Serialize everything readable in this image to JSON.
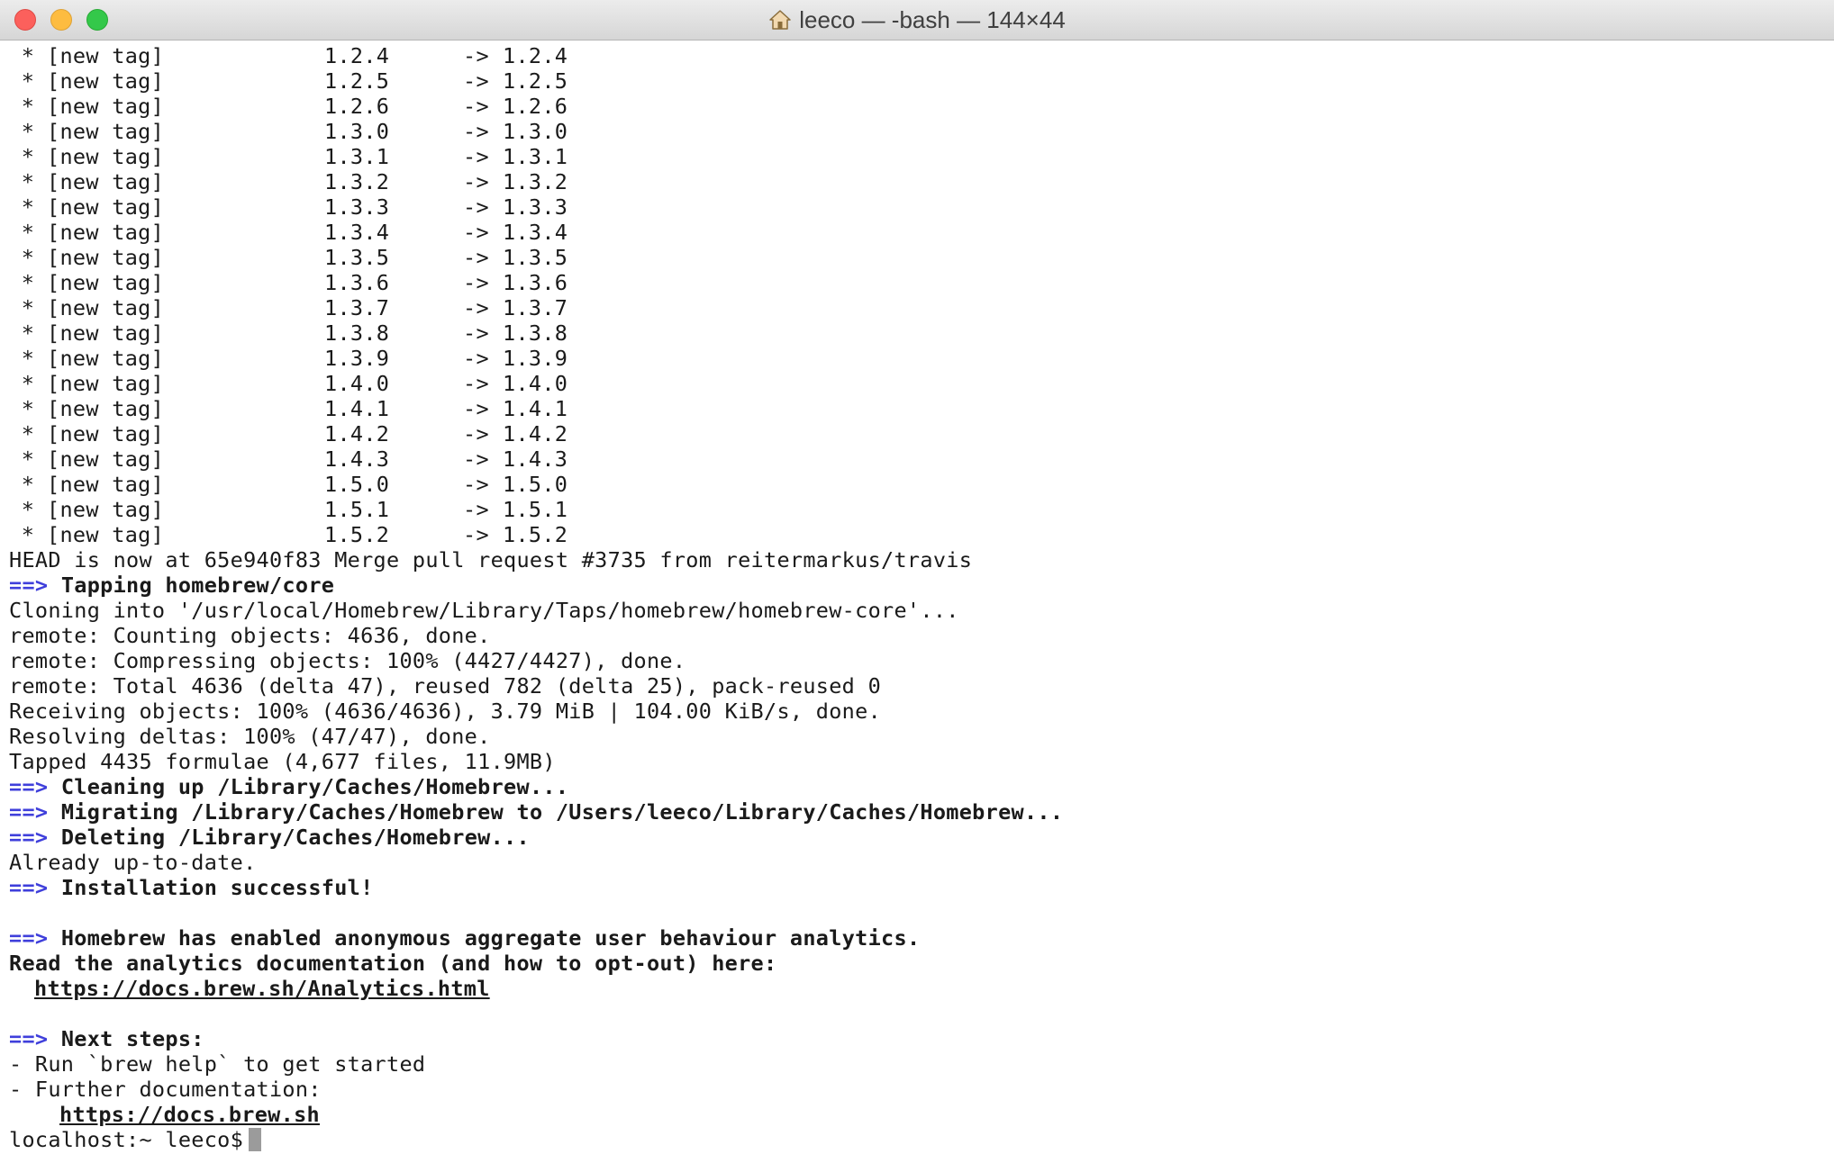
{
  "window": {
    "title": "leeco — -bash — 144×44",
    "icon": "home-folder-icon"
  },
  "tags": [
    {
      "star": "*",
      "label": "[new tag]",
      "from": "1.2.4",
      "arrow": "->",
      "to": "1.2.4"
    },
    {
      "star": "*",
      "label": "[new tag]",
      "from": "1.2.5",
      "arrow": "->",
      "to": "1.2.5"
    },
    {
      "star": "*",
      "label": "[new tag]",
      "from": "1.2.6",
      "arrow": "->",
      "to": "1.2.6"
    },
    {
      "star": "*",
      "label": "[new tag]",
      "from": "1.3.0",
      "arrow": "->",
      "to": "1.3.0"
    },
    {
      "star": "*",
      "label": "[new tag]",
      "from": "1.3.1",
      "arrow": "->",
      "to": "1.3.1"
    },
    {
      "star": "*",
      "label": "[new tag]",
      "from": "1.3.2",
      "arrow": "->",
      "to": "1.3.2"
    },
    {
      "star": "*",
      "label": "[new tag]",
      "from": "1.3.3",
      "arrow": "->",
      "to": "1.3.3"
    },
    {
      "star": "*",
      "label": "[new tag]",
      "from": "1.3.4",
      "arrow": "->",
      "to": "1.3.4"
    },
    {
      "star": "*",
      "label": "[new tag]",
      "from": "1.3.5",
      "arrow": "->",
      "to": "1.3.5"
    },
    {
      "star": "*",
      "label": "[new tag]",
      "from": "1.3.6",
      "arrow": "->",
      "to": "1.3.6"
    },
    {
      "star": "*",
      "label": "[new tag]",
      "from": "1.3.7",
      "arrow": "->",
      "to": "1.3.7"
    },
    {
      "star": "*",
      "label": "[new tag]",
      "from": "1.3.8",
      "arrow": "->",
      "to": "1.3.8"
    },
    {
      "star": "*",
      "label": "[new tag]",
      "from": "1.3.9",
      "arrow": "->",
      "to": "1.3.9"
    },
    {
      "star": "*",
      "label": "[new tag]",
      "from": "1.4.0",
      "arrow": "->",
      "to": "1.4.0"
    },
    {
      "star": "*",
      "label": "[new tag]",
      "from": "1.4.1",
      "arrow": "->",
      "to": "1.4.1"
    },
    {
      "star": "*",
      "label": "[new tag]",
      "from": "1.4.2",
      "arrow": "->",
      "to": "1.4.2"
    },
    {
      "star": "*",
      "label": "[new tag]",
      "from": "1.4.3",
      "arrow": "->",
      "to": "1.4.3"
    },
    {
      "star": "*",
      "label": "[new tag]",
      "from": "1.5.0",
      "arrow": "->",
      "to": "1.5.0"
    },
    {
      "star": "*",
      "label": "[new tag]",
      "from": "1.5.1",
      "arrow": "->",
      "to": "1.5.1"
    },
    {
      "star": "*",
      "label": "[new tag]",
      "from": "1.5.2",
      "arrow": "->",
      "to": "1.5.2"
    }
  ],
  "output": {
    "arrow": "==>",
    "head": "HEAD is now at 65e940f83 Merge pull request #3735 from reitermarkus/travis",
    "tapping": "Tapping homebrew/core",
    "cloning": "Cloning into '/usr/local/Homebrew/Library/Taps/homebrew/homebrew-core'...",
    "counting": "remote: Counting objects: 4636, done.",
    "compressing": "remote: Compressing objects: 100% (4427/4427), done.",
    "total": "remote: Total 4636 (delta 47), reused 782 (delta 25), pack-reused 0",
    "receiving": "Receiving objects: 100% (4636/4636), 3.79 MiB | 104.00 KiB/s, done.",
    "resolving": "Resolving deltas: 100% (47/47), done.",
    "tapped": "Tapped 4435 formulae (4,677 files, 11.9MB)",
    "cleaning": "Cleaning up /Library/Caches/Homebrew...",
    "migrating": "Migrating /Library/Caches/Homebrew to /Users/leeco/Library/Caches/Homebrew...",
    "deleting": "Deleting /Library/Caches/Homebrew...",
    "uptodate": "Already up-to-date.",
    "success": "Installation successful!",
    "analytics_heading": "Homebrew has enabled anonymous aggregate user behaviour analytics.",
    "analytics_read": "Read the analytics documentation (and how to opt-out) here:",
    "analytics_url": "https://docs.brew.sh/Analytics.html",
    "next_steps": "Next steps:",
    "step_run": "- Run `brew help` to get started",
    "step_docs": "- Further documentation:",
    "docs_url": "https://docs.brew.sh",
    "prompt": "localhost:~ leeco$"
  }
}
